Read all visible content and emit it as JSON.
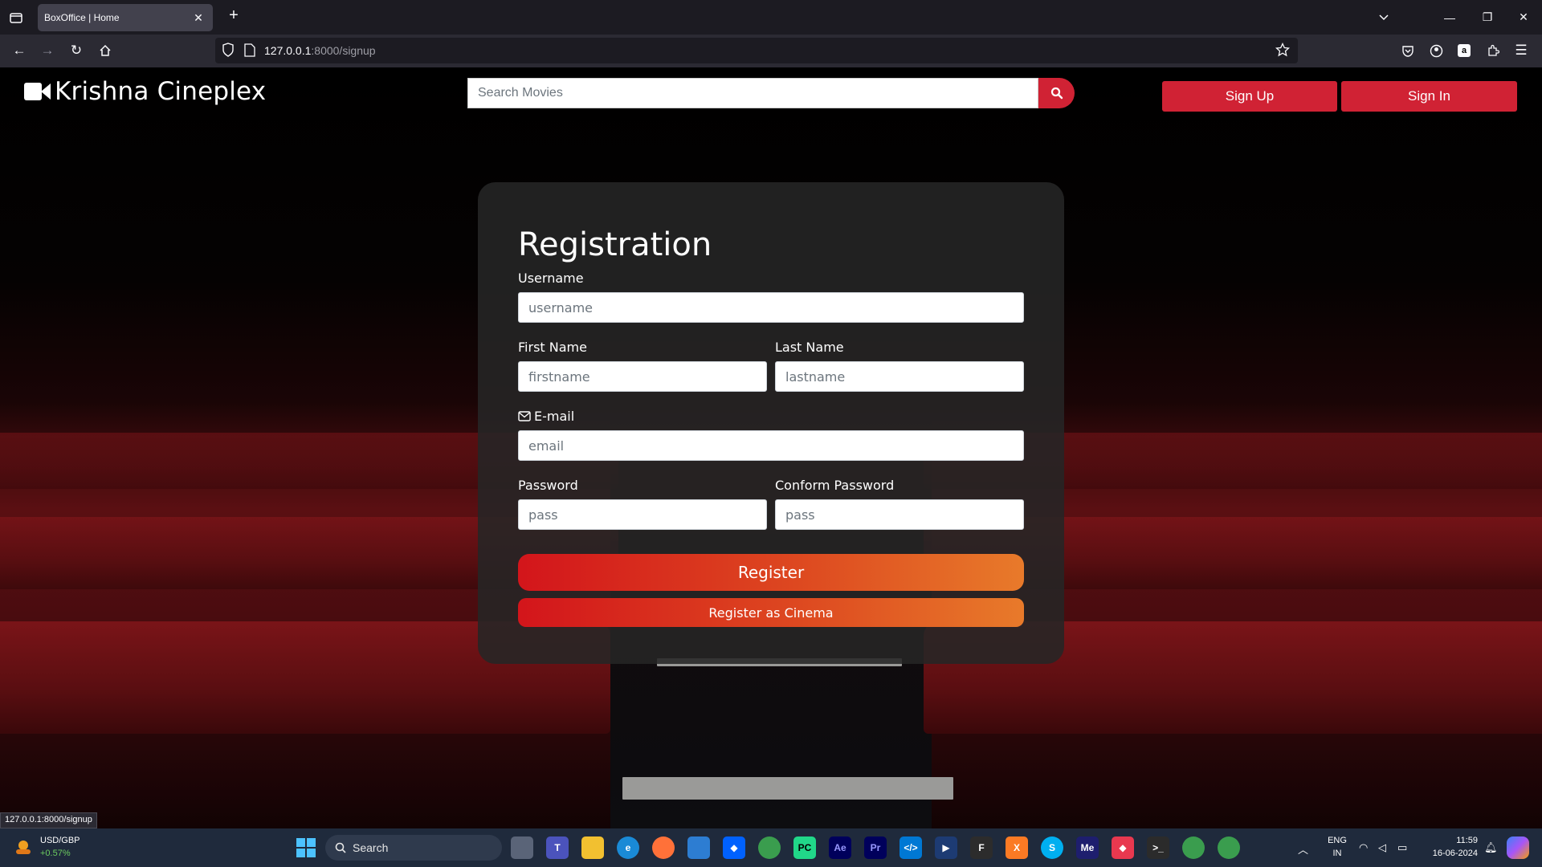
{
  "browser": {
    "tab_title": "BoxOffice | Home",
    "url_host": "127.0.0.1",
    "url_path": ":8000/signup",
    "status_url": "127.0.0.1:8000/signup"
  },
  "site": {
    "brand": "Krishna Cineplex",
    "search_placeholder": "Search Movies",
    "signup_label": "Sign Up",
    "signin_label": "Sign In"
  },
  "form": {
    "title": "Registration",
    "username_label": "Username",
    "username_placeholder": "username",
    "firstname_label": "First Name",
    "firstname_placeholder": "firstname",
    "lastname_label": "Last Name",
    "lastname_placeholder": "lastname",
    "email_label": "E-mail",
    "email_placeholder": "email",
    "password_label": "Password",
    "password_placeholder": "pass",
    "confirm_label": "Conform Password",
    "confirm_placeholder": "pass",
    "register_label": "Register",
    "register_cinema_label": "Register as Cinema"
  },
  "taskbar": {
    "ticker_name": "USD/GBP",
    "ticker_change": "+0.57%",
    "search_label": "Search",
    "lang_line1": "ENG",
    "lang_line2": "IN",
    "time": "11:59",
    "date": "16-06-2024"
  },
  "colors": {
    "accent_red": "#d02234",
    "gradient_start": "#d3151b",
    "gradient_end": "#e87a2a"
  }
}
